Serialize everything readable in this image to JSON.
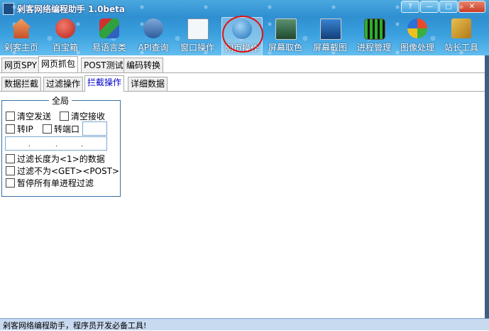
{
  "window": {
    "title": "剁客网络编程助手 1.0beta",
    "controls": [
      "?",
      "—",
      "□",
      "✕"
    ]
  },
  "toolbar": {
    "items": [
      {
        "label": "剁客主页",
        "icon": "home-icon",
        "color": "#d9663a"
      },
      {
        "label": "百宝箱",
        "icon": "toolbox-icon",
        "color": "#c9322c"
      },
      {
        "label": "易语言类",
        "icon": "cubes-icon",
        "color": "#2f9a3a"
      },
      {
        "label": "API查询",
        "icon": "api-help-icon",
        "color": "#3a6fb8"
      },
      {
        "label": "窗口操作",
        "icon": "window-target-icon",
        "color": "#e7edf3"
      },
      {
        "label": "网页操作",
        "icon": "globe-gear-icon",
        "color": "#2d86c8"
      },
      {
        "label": "屏幕取色",
        "icon": "screen-color-icon",
        "color": "#3a7a4a"
      },
      {
        "label": "屏幕截图",
        "icon": "screen-capture-icon",
        "color": "#1f5aa0"
      },
      {
        "label": "进程管理",
        "icon": "process-bars-icon",
        "color": "#2b8a2b"
      },
      {
        "label": "图像处理",
        "icon": "image-process-icon",
        "color": "#3d8bd0"
      },
      {
        "label": "站长工具",
        "icon": "webmaster-tools-icon",
        "color": "#d2a02c"
      }
    ]
  },
  "tabs_main": [
    "网页SPY",
    "网页抓包",
    "POST测试",
    "编码转换"
  ],
  "tabs_sub": [
    "数据拦截",
    "过滤操作",
    "拦截操作",
    "详细数据"
  ],
  "group": {
    "title": "全局",
    "checkboxes": {
      "clear_send": "清空发送",
      "clear_recv": "清空接收",
      "to_ip": "转IP",
      "to_port": "转端口",
      "filter_len": "过滤长度为<1>的数据",
      "filter_not": "过滤不为<GET><POST>",
      "pause_all": "暂停所有单进程过滤"
    },
    "port_value": "",
    "ip_value": ". . ."
  },
  "status_text": "剁客网络编程助手，程序员开发必备工具!"
}
